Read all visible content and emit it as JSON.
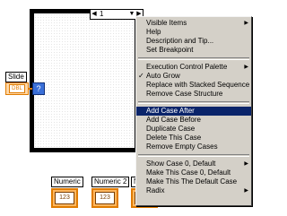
{
  "case_structure": {
    "selector_value": "1",
    "left_arrow": "◀",
    "dropdown_arrow": "▼",
    "right_arrow": "▶"
  },
  "slide": {
    "label": "Slide",
    "terminal_text": "DBL"
  },
  "case_selector_terminal": "?",
  "numerics": [
    {
      "label": "Numeric",
      "value": "123"
    },
    {
      "label": "Numeric 2",
      "value": "123"
    },
    {
      "label": "N",
      "value": "123"
    }
  ],
  "menu": {
    "groups": [
      [
        {
          "label": "Visible Items",
          "submenu": true
        },
        {
          "label": "Help"
        },
        {
          "label": "Description and Tip..."
        },
        {
          "label": "Set Breakpoint"
        }
      ],
      [
        {
          "label": "Execution Control Palette",
          "submenu": true
        },
        {
          "label": "Auto Grow",
          "checked": true
        },
        {
          "label": "Replace with Stacked Sequence"
        },
        {
          "label": "Remove Case Structure"
        }
      ],
      [
        {
          "label": "Add Case After",
          "highlighted": true
        },
        {
          "label": "Add Case Before"
        },
        {
          "label": "Duplicate Case"
        },
        {
          "label": "Delete This Case"
        },
        {
          "label": "Remove Empty Cases"
        }
      ],
      [
        {
          "label": "Show Case 0, Default",
          "submenu": true
        },
        {
          "label": "Make This Case 0, Default"
        },
        {
          "label": "Make This The Default Case"
        },
        {
          "label": "Radix",
          "submenu": true
        }
      ]
    ],
    "submenu_icon": "right-triangle-icon",
    "check_glyph": "✓",
    "submenu_glyph": "▶"
  }
}
